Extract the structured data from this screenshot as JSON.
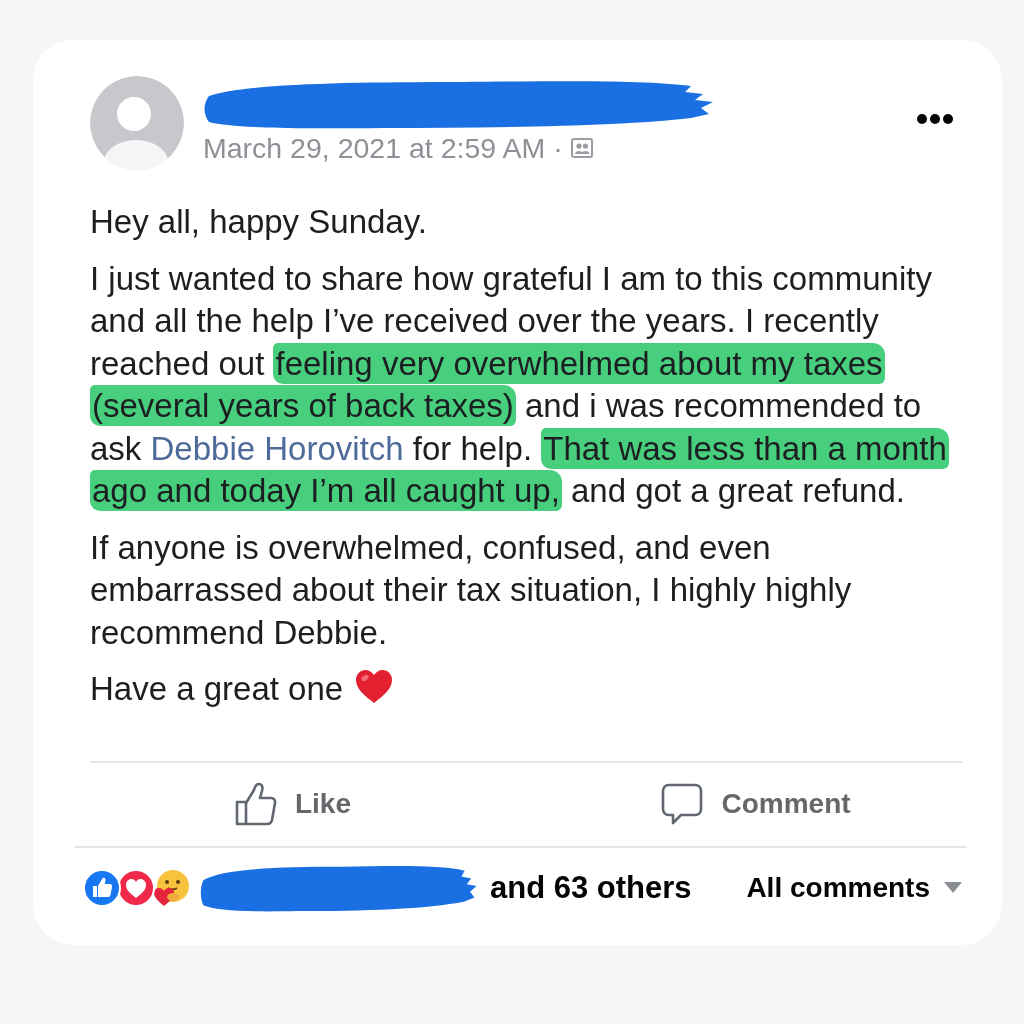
{
  "header": {
    "timestamp": "March 29, 2021 at 2:59 AM",
    "separator": "·"
  },
  "paragraphs": [
    {
      "segments": [
        {
          "kind": "plain",
          "text": "Hey all, happy Sunday."
        }
      ]
    },
    {
      "segments": [
        {
          "kind": "plain",
          "text": "I just wanted to share how grateful I am to this community and all the help I’ve received over the years. I recently reached out "
        },
        {
          "kind": "highlight",
          "text": "feeling very overwhelmed about my taxes (several years of back taxes)"
        },
        {
          "kind": "plain",
          "text": " and i was recommended to ask "
        },
        {
          "kind": "link",
          "text": "Debbie Horovitch"
        },
        {
          "kind": "plain",
          "text": " for help. "
        },
        {
          "kind": "highlight",
          "text": "That was less than a month ago and today I’m all caught up,"
        },
        {
          "kind": "plain",
          "text": " and got a great refund."
        }
      ]
    },
    {
      "segments": [
        {
          "kind": "plain",
          "text": "If anyone is overwhelmed, confused, and even embarrassed about their tax situation, I highly highly recommend Debbie."
        }
      ]
    },
    {
      "segments": [
        {
          "kind": "plain",
          "text": "Have a great one"
        },
        {
          "kind": "heart_emoji"
        }
      ]
    }
  ],
  "actions": [
    {
      "kind": "like",
      "label": "Like"
    },
    {
      "kind": "comment",
      "label": "Comment"
    }
  ],
  "reactions": {
    "summary": "and 63 others"
  },
  "comments_filter": {
    "label": "All comments"
  }
}
